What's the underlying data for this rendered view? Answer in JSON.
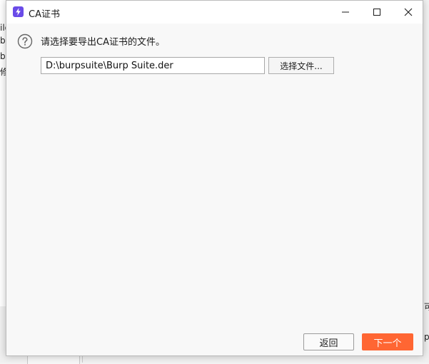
{
  "background": {
    "left_fragments": [
      "ilo",
      "b",
      "b",
      "修"
    ],
    "right_fragments": [
      "可",
      "p"
    ]
  },
  "dialog": {
    "title": "CA证书",
    "prompt": "请选择要导出CA证书的文件。",
    "file_path": "D:\\burpsuite\\Burp Suite.der",
    "choose_file_label": "选择文件...",
    "back_label": "返回",
    "next_label": "下一个"
  },
  "colors": {
    "accent": "#ff6633",
    "app_icon": "#6a4be8"
  }
}
